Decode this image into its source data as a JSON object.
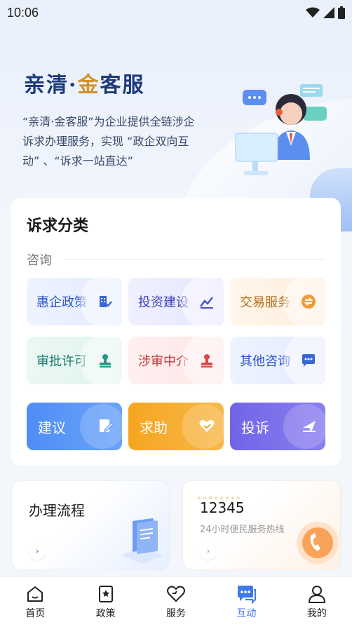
{
  "status_bar": {
    "time": "10:06"
  },
  "hero": {
    "brand_part1": "亲清",
    "brand_dot": "·",
    "brand_part2": "金",
    "brand_part3": "客服",
    "description": "“亲清·金客服”为企业提供全链涉企诉求办理服务，实现 “政企双向互动” 、“诉求一站直达”"
  },
  "categories": {
    "title": "诉求分类",
    "section_label": "咨询",
    "tiles": [
      {
        "label": "惠企政策",
        "icon": "building-check-icon",
        "color": "#2b55c9"
      },
      {
        "label": "投资建设",
        "icon": "chart-line-icon",
        "color": "#3a3fb4"
      },
      {
        "label": "交易服务",
        "icon": "exchange-icon",
        "color": "#b5701d"
      },
      {
        "label": "审批许可",
        "icon": "stamp-icon",
        "color": "#177a6c"
      },
      {
        "label": "涉审中介",
        "icon": "seal-icon",
        "color": "#c23a3a"
      },
      {
        "label": "其他咨询",
        "icon": "chat-dots-icon",
        "color": "#2b55c9"
      }
    ],
    "actions": [
      {
        "label": "建议",
        "icon": "edit-icon"
      },
      {
        "label": "求助",
        "icon": "heart-hand-icon"
      },
      {
        "label": "投诉",
        "icon": "send-icon"
      }
    ]
  },
  "panels": {
    "process_title": "办理流程",
    "hotline_number": "12345",
    "hotline_desc": "24小时便民服务热线",
    "arrow": "›"
  },
  "tabbar": {
    "items": [
      {
        "label": "首页",
        "icon": "home-icon"
      },
      {
        "label": "政策",
        "icon": "policy-icon"
      },
      {
        "label": "服务",
        "icon": "heart-icon"
      },
      {
        "label": "互动",
        "icon": "chat-icon",
        "active": true
      },
      {
        "label": "我的",
        "icon": "person-icon"
      }
    ],
    "active_color": "#3f78e8"
  }
}
